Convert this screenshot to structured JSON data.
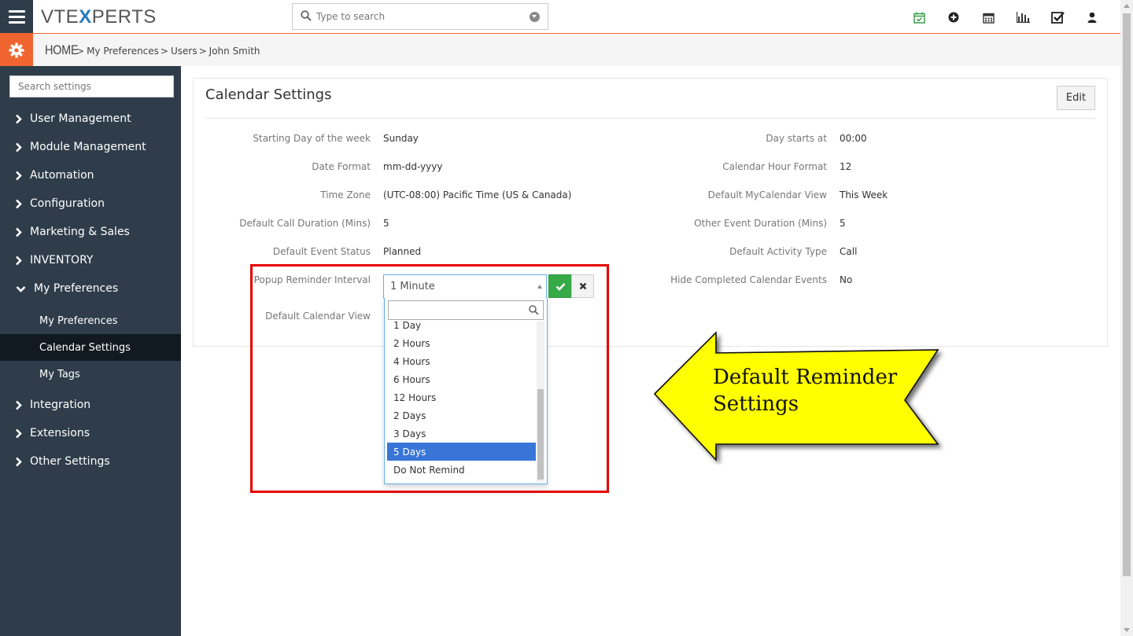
{
  "header": {
    "logo_prefix": "VTE",
    "logo_x": "X",
    "logo_suffix": "PERTS",
    "search_placeholder": "Type to search",
    "icons": [
      "calendar-check-icon",
      "plus-circle-icon",
      "calendar-icon",
      "bar-chart-icon",
      "checkbox-icon",
      "user-icon"
    ],
    "accent_color": "#f0652f"
  },
  "breadcrumb": {
    "home": "HOME",
    "separator": ">",
    "items": [
      "My Preferences",
      "Users",
      "John Smith"
    ]
  },
  "sidebar": {
    "search_placeholder": "Search settings",
    "items": [
      {
        "label": "User Management"
      },
      {
        "label": "Module Management"
      },
      {
        "label": "Automation"
      },
      {
        "label": "Configuration"
      },
      {
        "label": "Marketing & Sales"
      },
      {
        "label": "INVENTORY"
      },
      {
        "label": "My Preferences"
      },
      {
        "label": "Integration"
      },
      {
        "label": "Extensions"
      },
      {
        "label": "Other Settings"
      }
    ],
    "sub_items": [
      {
        "label": "My Preferences"
      },
      {
        "label": "Calendar Settings"
      },
      {
        "label": "My Tags"
      }
    ],
    "bg_color": "#2f3d4a",
    "active_color": "#121a21"
  },
  "calendar": {
    "title": "Calendar Settings",
    "edit_label": "Edit",
    "fields_left": [
      {
        "label": "Starting Day of the week",
        "value": "Sunday"
      },
      {
        "label": "Date Format",
        "value": "mm-dd-yyyy"
      },
      {
        "label": "Time Zone",
        "value": "(UTC-08:00) Pacific Time (US & Canada)"
      },
      {
        "label": "Default Call Duration (Mins)",
        "value": "5"
      },
      {
        "label": "Default Event Status",
        "value": "Planned"
      },
      {
        "label": "Popup Reminder Interval",
        "value": ""
      },
      {
        "label": "Default Calendar View",
        "value": ""
      }
    ],
    "fields_right": [
      {
        "label": "Day starts at",
        "value": "00:00"
      },
      {
        "label": "Calendar Hour Format",
        "value": "12"
      },
      {
        "label": "Default MyCalendar View",
        "value": "This Week"
      },
      {
        "label": "Other Event Duration (Mins)",
        "value": "5"
      },
      {
        "label": "Default Activity Type",
        "value": "Call"
      },
      {
        "label": "Hide Completed Calendar Events",
        "value": "No"
      }
    ],
    "reminder_select": {
      "selected": "1 Minute",
      "options": [
        "1 Day",
        "2 Hours",
        "4 Hours",
        "6 Hours",
        "12 Hours",
        "2 Days",
        "3 Days",
        "5 Days",
        "Do Not Remind"
      ],
      "highlighted": "5 Days"
    }
  },
  "callout": {
    "line1": "Default Reminder",
    "line2": "Settings",
    "fill_color": "#ffff00",
    "box_color": "#e60000"
  }
}
